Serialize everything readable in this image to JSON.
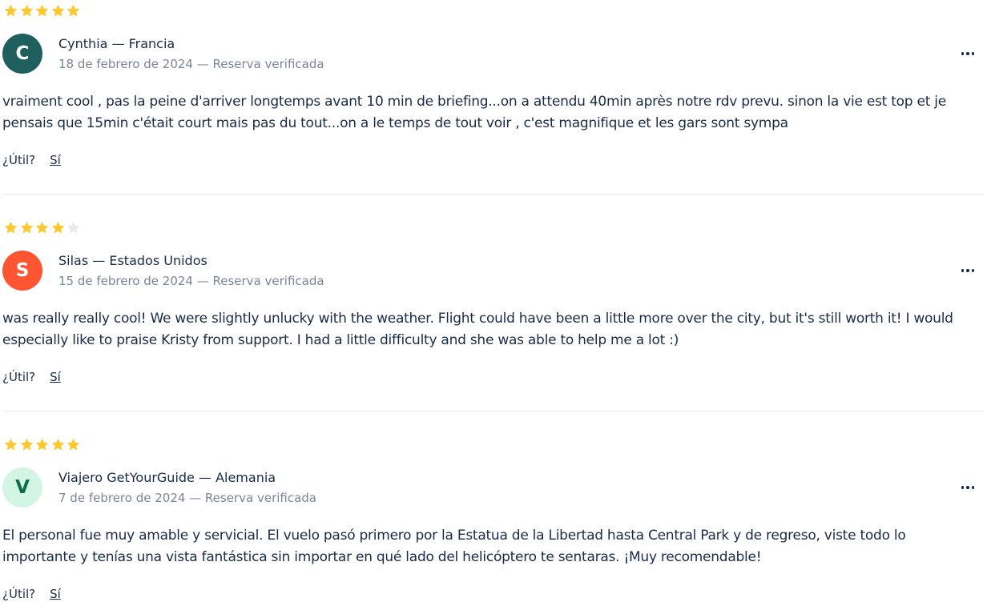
{
  "colors": {
    "star_filled": "#fdc72f",
    "star_empty": "#e8eaee",
    "text": "#1a2b49",
    "muted": "#7a8599"
  },
  "reviews": [
    {
      "rating": 5,
      "avatar_letter": "C",
      "avatar_bg": "#1f5f5e",
      "avatar_fg": "#ffffff",
      "author": "Cynthia — Francia",
      "meta": "18 de febrero de 2024 — Reserva verificada",
      "text": "vraiment cool , pas la peine d'arriver longtemps avant 10 min de briefing...on a attendu 40min après notre rdv prevu. sinon la vie est top et je pensais que 15min c'était court mais pas du tout...on a le temps de tout voir , c'est magnifique et les gars sont sympa",
      "helpful_label": "¿Útil?",
      "yes_label": "Sí"
    },
    {
      "rating": 4,
      "avatar_letter": "S",
      "avatar_bg": "#ff5533",
      "avatar_fg": "#ffffff",
      "author": "Silas — Estados Unidos",
      "meta": "15 de febrero de 2024 — Reserva verificada",
      "text": "was really really cool! We were slightly unlucky with the weather. Flight could have been a little more over the city, but it's still worth it! I would especially like to praise Kristy from support. I had a little difficulty and she was able to help me a lot :)",
      "helpful_label": "¿Útil?",
      "yes_label": "Sí"
    },
    {
      "rating": 5,
      "avatar_letter": "V",
      "avatar_bg": "#d3f5e3",
      "avatar_fg": "#0f6d46",
      "author": "Viajero GetYourGuide — Alemania",
      "meta": "7 de febrero de 2024 — Reserva verificada",
      "text": "El personal fue muy amable y servicial. El vuelo pasó primero por la Estatua de la Libertad hasta Central Park y de regreso, viste todo lo importante y tenías una vista fantástica sin importar en qué lado del helicóptero te sentaras. ¡Muy recomendable!",
      "helpful_label": "¿Útil?",
      "yes_label": "Sí"
    }
  ]
}
